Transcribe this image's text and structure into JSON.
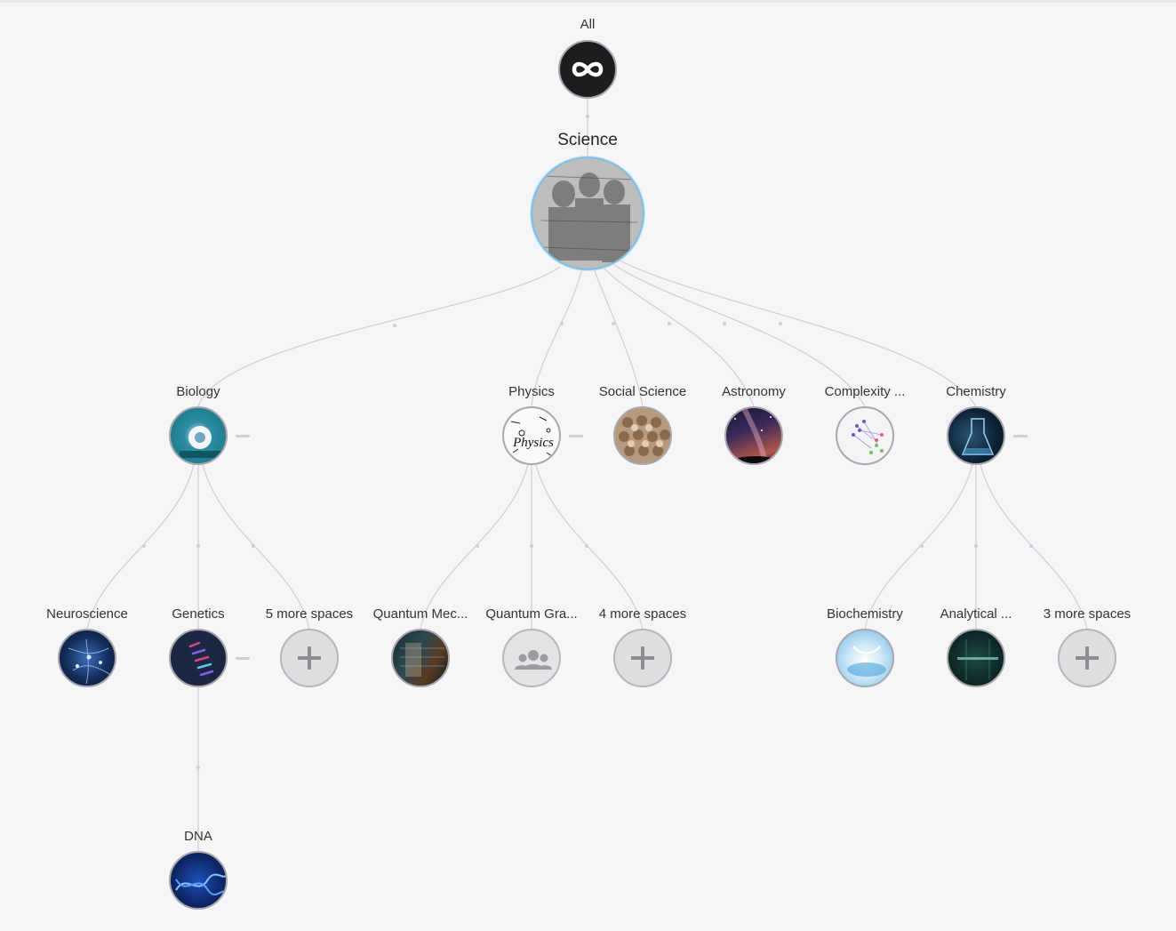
{
  "root": {
    "label": "All",
    "icon": "infinity-icon"
  },
  "current": {
    "label": "Science",
    "image": "vintage-scientists-photo"
  },
  "children": [
    {
      "key": "biology",
      "label": "Biology",
      "image": "biology-lab-illustration"
    },
    {
      "key": "physics",
      "label": "Physics",
      "image": "physics-doodle"
    },
    {
      "key": "social",
      "label": "Social Science",
      "image": "crowd-faces"
    },
    {
      "key": "astronomy",
      "label": "Astronomy",
      "image": "milky-way-night"
    },
    {
      "key": "complexity",
      "label": "Complexity ...",
      "image": "network-graph"
    },
    {
      "key": "chemistry",
      "label": "Chemistry",
      "image": "chemistry-flask"
    }
  ],
  "grandchildren": {
    "biology": [
      {
        "label": "Neuroscience",
        "image": "neurons-blue"
      },
      {
        "label": "Genetics",
        "image": "genetics-helix"
      },
      {
        "label": "5 more spaces",
        "image": "plus-icon"
      }
    ],
    "physics": [
      {
        "label": "Quantum Mec...",
        "image": "quantum-screen"
      },
      {
        "label": "Quantum Gra...",
        "image": "group-icon"
      },
      {
        "label": "4 more spaces",
        "image": "plus-icon"
      }
    ],
    "chemistry": [
      {
        "label": "Biochemistry",
        "image": "biochemistry-glass"
      },
      {
        "label": "Analytical ...",
        "image": "analytical-chemistry"
      },
      {
        "label": "3 more spaces",
        "image": "plus-icon"
      }
    ]
  },
  "genetics_children": [
    {
      "label": "DNA",
      "image": "dna-helix"
    }
  ],
  "colors": {
    "background": "#f6f6f8",
    "link": "#cfcfd3",
    "selected_ring": "#7fc0ec",
    "plus_fill": "#dedee0"
  }
}
